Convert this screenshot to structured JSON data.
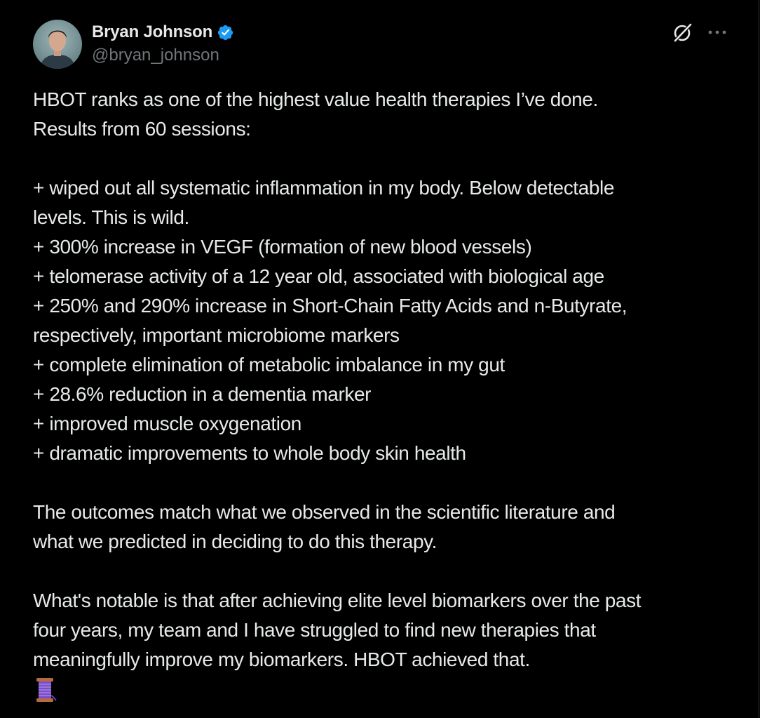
{
  "author": {
    "display_name": "Bryan Johnson",
    "handle": "@bryan_johnson",
    "verified_color": "#1d9bf0"
  },
  "icons": {
    "grok": "grok-icon",
    "more": "more-icon",
    "thread": "thread-spool-icon"
  },
  "tweet": {
    "paragraph1": [
      "HBOT ranks as one of the highest value health therapies I’ve done.",
      "Results from 60 sessions:"
    ],
    "paragraph2": [
      "+ wiped out all systematic inflammation in my body.  Below detectable",
      "levels. This is wild.",
      "+ 300% increase in VEGF (formation of new blood vessels)",
      "+ telomerase activity of a 12 year old, associated with biological age",
      "+ 250% and 290% increase in Short-Chain Fatty Acids and n-Butyrate,",
      "respectively, important microbiome markers",
      "+ complete elimination of metabolic imbalance in my gut",
      "+ 28.6% reduction in a dementia marker",
      "+ improved muscle oxygenation",
      "+ dramatic improvements to whole body skin health"
    ],
    "paragraph3": [
      "The outcomes match what we observed in the scientific literature and",
      "what we predicted in deciding to do this therapy."
    ],
    "paragraph4": [
      "What's notable is that after achieving elite level biomarkers over the past",
      "four years, my team and I have struggled to find new therapies that",
      "meaningfully improve my biomarkers. HBOT achieved that."
    ]
  }
}
